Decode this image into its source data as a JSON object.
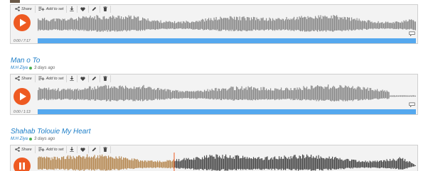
{
  "tracks": [
    {
      "title": "",
      "user": "",
      "ago": "",
      "time": "0:00 / 7:17",
      "state": "paused",
      "progress": 0,
      "seed": 11
    },
    {
      "title": "Man o To",
      "user": "M.H Ziya",
      "ago": "3 days ago",
      "time": "0:00 / 1:13",
      "state": "paused",
      "progress": 0,
      "seed": 23
    },
    {
      "title": "Shahab Tolouie My Heart",
      "user": "M.H Ziya",
      "ago": "3 days ago",
      "time": "",
      "state": "playing",
      "progress": 0.36,
      "seed": 37
    }
  ],
  "toolbar": {
    "share_label": "Share",
    "add_to_set_label": "Add to set"
  },
  "colors": {
    "accent": "#ee5a22",
    "link": "#1d7ec8",
    "progress_bar": "#55a8ee",
    "wave_idle": "#8a8a8a",
    "wave_played": "#b78a55",
    "wave_unplayed_dark": "#4a4a4a",
    "online_dot": "#4caf50"
  },
  "icons": {
    "share": "share-icon",
    "add_to_set": "playlist-add-icon",
    "download": "download-icon",
    "like": "heart-icon",
    "edit": "pencil-icon",
    "delete": "trash-icon",
    "play": "play-icon",
    "pause": "pause-icon",
    "comment": "comment-icon"
  }
}
